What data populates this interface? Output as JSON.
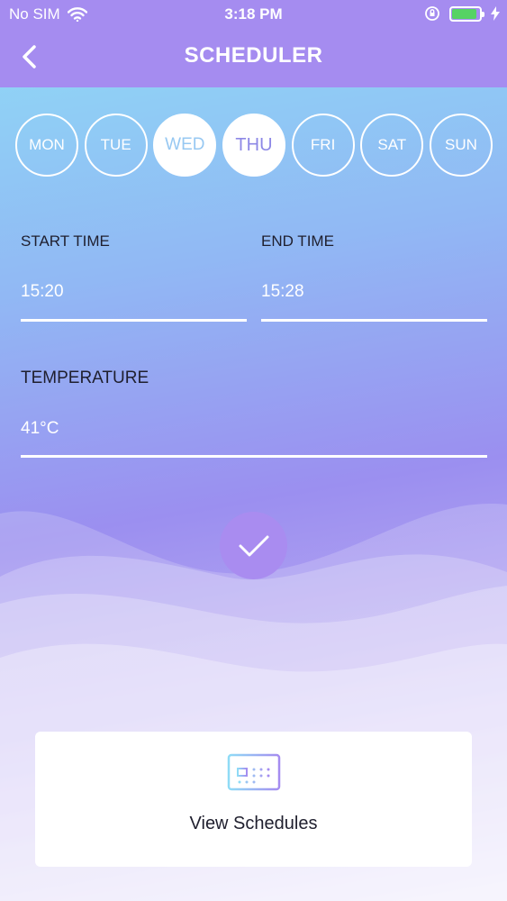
{
  "status_bar": {
    "carrier": "No SIM",
    "time": "3:18 PM",
    "battery_level": 0.9
  },
  "header": {
    "title": "SCHEDULER",
    "back_icon": "chevron-left-icon"
  },
  "days": [
    {
      "label": "MON",
      "selected": false
    },
    {
      "label": "TUE",
      "selected": false
    },
    {
      "label": "WED",
      "selected": true
    },
    {
      "label": "THU",
      "selected": true
    },
    {
      "label": "FRI",
      "selected": false
    },
    {
      "label": "SAT",
      "selected": false
    },
    {
      "label": "SUN",
      "selected": false
    }
  ],
  "form": {
    "start_time_label": "START TIME",
    "start_time_value": "15:20",
    "end_time_label": "END TIME",
    "end_time_value": "15:28",
    "temperature_label": "TEMPERATURE",
    "temperature_value": "41°C"
  },
  "confirm_icon": "checkmark-icon",
  "view_schedules": {
    "label": "View Schedules",
    "icon": "calendar-icon"
  },
  "colors": {
    "header": "#a58cf0",
    "accent": "#a98cf0",
    "battery": "#56d364"
  }
}
